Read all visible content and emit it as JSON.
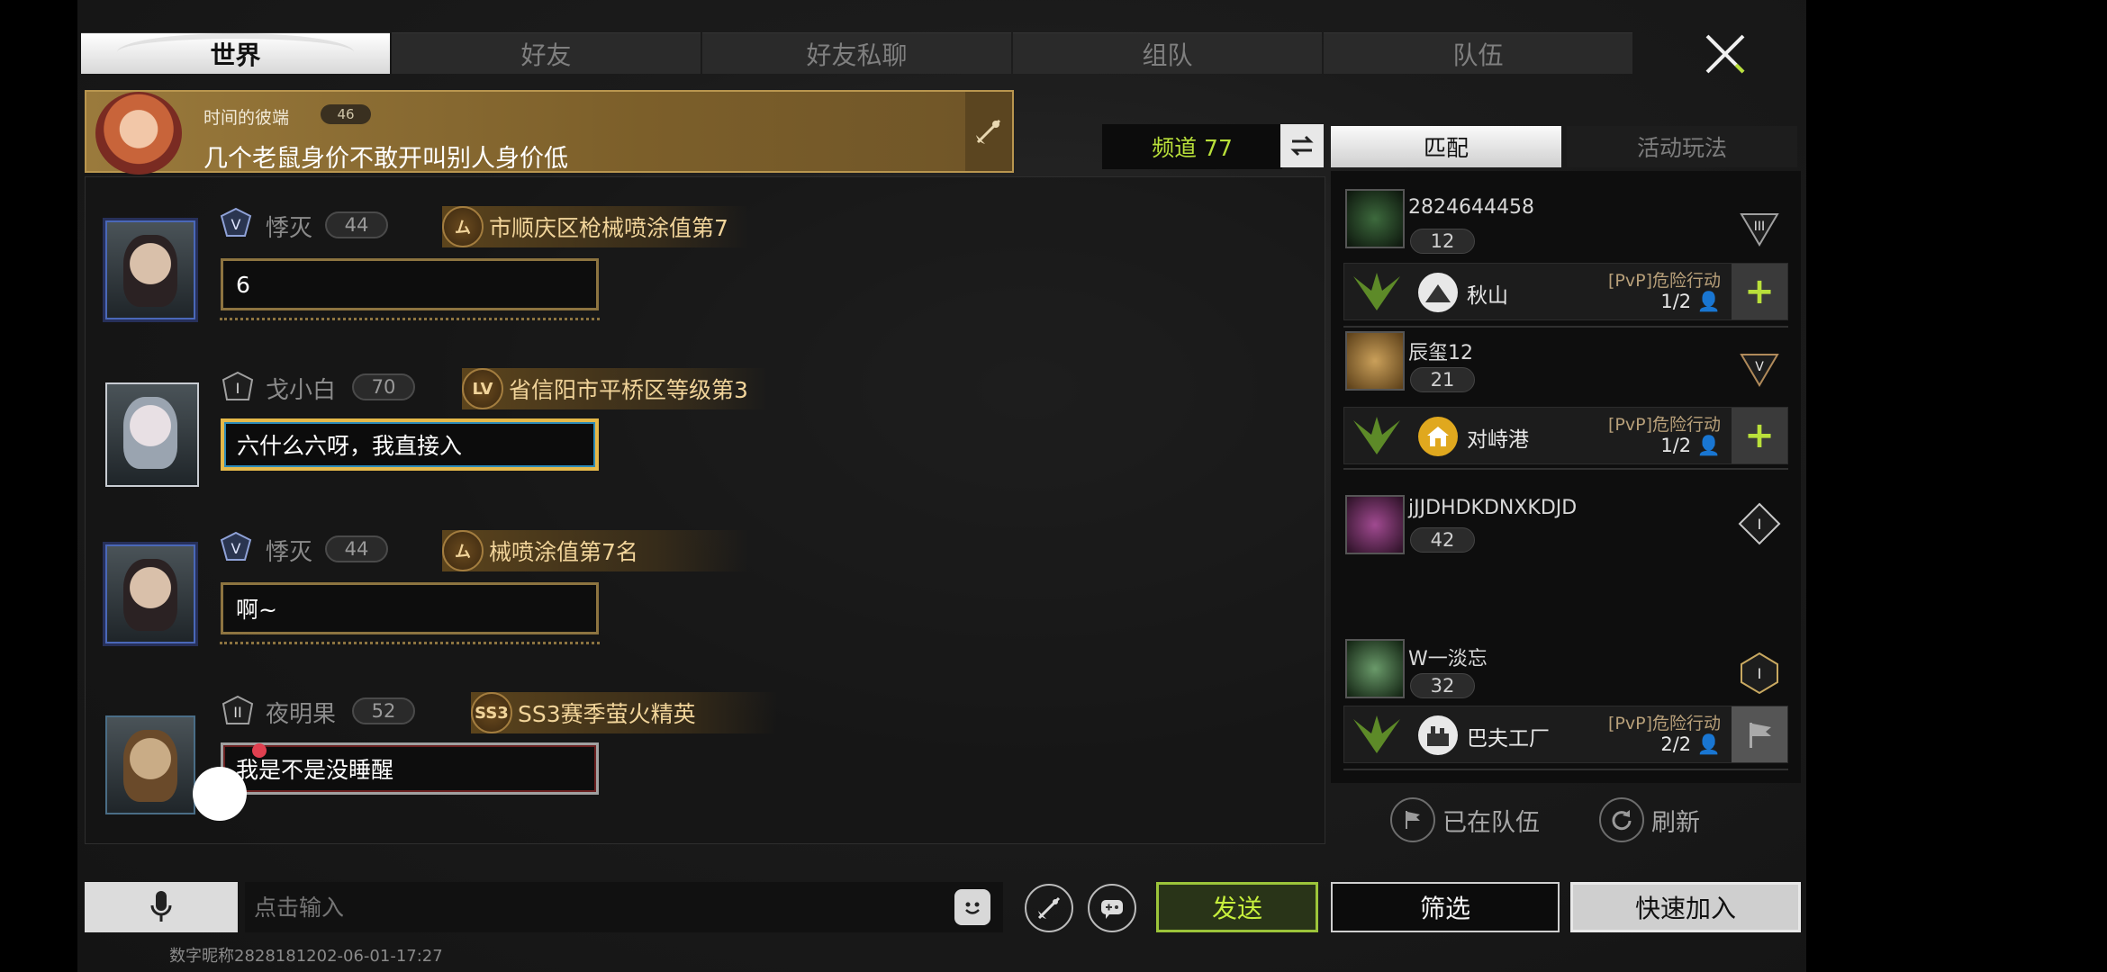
{
  "tabs": [
    "世界",
    "好友",
    "好友私聊",
    "组队",
    "队伍"
  ],
  "banner": {
    "name": "时间的彼端",
    "level": "46",
    "message": "几个老鼠身价不敢开叫别人身价低"
  },
  "channel": {
    "label": "频道 77"
  },
  "messages": [
    {
      "name": "悸灭",
      "level": "44",
      "title": "市顺庆区枪械喷涂值第7",
      "text": "6",
      "title_icon": "ム"
    },
    {
      "name": "戈小白",
      "level": "70",
      "title": "省信阳市平桥区等级第3",
      "text": "六什么六呀，我直接入",
      "title_icon": "LV"
    },
    {
      "name": "悸灭",
      "level": "44",
      "title": "械喷涂值第7名",
      "text": "啊~",
      "title_icon": "ム"
    },
    {
      "name": "夜明果",
      "level": "52",
      "title": "SS3赛季萤火精英",
      "text": "我是不是没睡醒",
      "title_icon": "SS3"
    }
  ],
  "side_tabs": {
    "match": "匹配",
    "activity": "活动玩法"
  },
  "match_list": [
    {
      "name": "2824644458",
      "level": "12",
      "rank": "III",
      "map": "秋山",
      "mode": "[PvP]危险行动",
      "slots": "1/2"
    },
    {
      "name": "辰玺12",
      "level": "21",
      "rank": "V",
      "map": "对峙港",
      "mode": "[PvP]危险行动",
      "slots": "1/2"
    },
    {
      "name": "jJJDHDKDNXKDJD",
      "level": "42",
      "rank": "I"
    },
    {
      "name": "W一淡忘",
      "level": "32",
      "rank": "I",
      "map": "巴夫工厂",
      "mode": "[PvP]危险行动",
      "slots": "2/2"
    }
  ],
  "side_footer": {
    "in_team": "已在队伍",
    "refresh": "刷新"
  },
  "input": {
    "placeholder": "点击输入"
  },
  "buttons": {
    "send": "发送",
    "filter": "筛选",
    "quick_join": "快速加入"
  },
  "footer_note": "数字昵称2828181202-06-01-17:27",
  "colors": {
    "accent": "#b9e03a",
    "gold": "#b9964f"
  }
}
